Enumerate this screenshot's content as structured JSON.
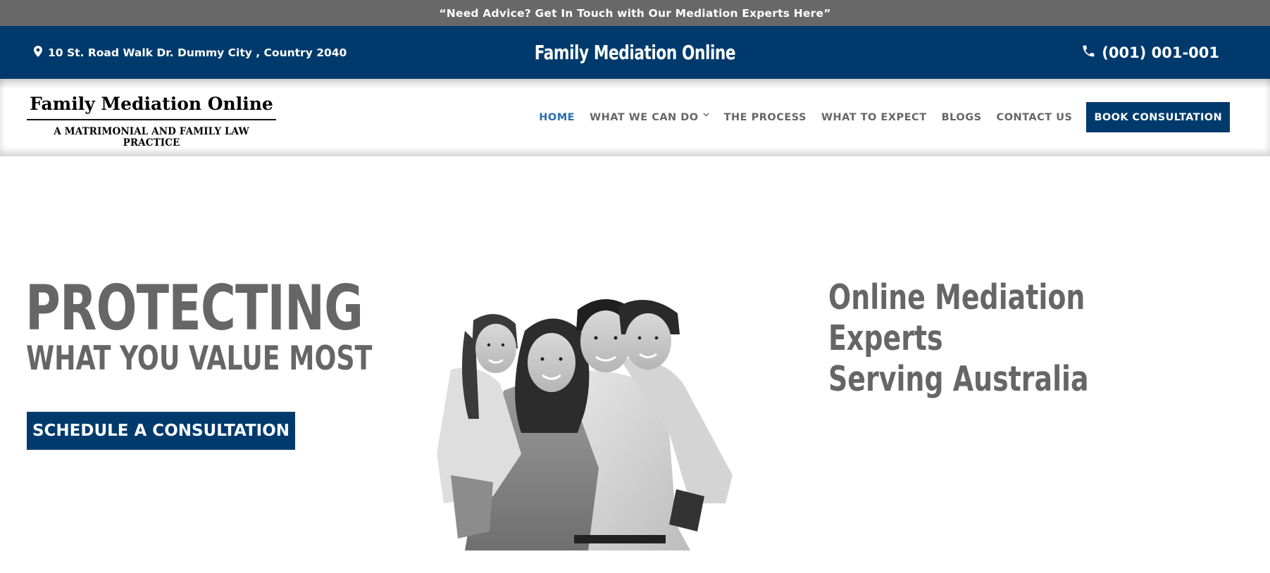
{
  "announcement": {
    "text": "“Need Advice? Get In Touch with Our Mediation Experts Here”"
  },
  "infobar": {
    "address": "10 St. Road Walk Dr. Dummy City , Country 2040",
    "address_icon": "map-pin-icon",
    "site_title": "Family Mediation Online",
    "phone": "(001) 001-001",
    "phone_icon": "phone-icon"
  },
  "logo": {
    "name": "Family Mediation Online",
    "tagline": "A MATRIMONIAL AND FAMILY LAW PRACTICE"
  },
  "nav": {
    "items": [
      {
        "label": "HOME",
        "active": true
      },
      {
        "label": "WHAT WE CAN DO",
        "has_dropdown": true
      },
      {
        "label": "THE PROCESS"
      },
      {
        "label": "WHAT TO EXPECT"
      },
      {
        "label": "BLOGS"
      },
      {
        "label": "CONTACT US"
      }
    ],
    "cta_label": "BOOK CONSULTATION"
  },
  "hero": {
    "headline": "PROTECTING",
    "subheadline": "WHAT YOU VALUE MOST",
    "cta_label": "SCHEDULE A CONSULTATION",
    "right_line1": "Online Mediation Experts",
    "right_line2": "Serving Australia",
    "image": "family-photo"
  },
  "colors": {
    "brand_blue": "#003a6c",
    "announce_gray": "#686868",
    "text_gray": "#666666",
    "active_link": "#2a6db0"
  }
}
